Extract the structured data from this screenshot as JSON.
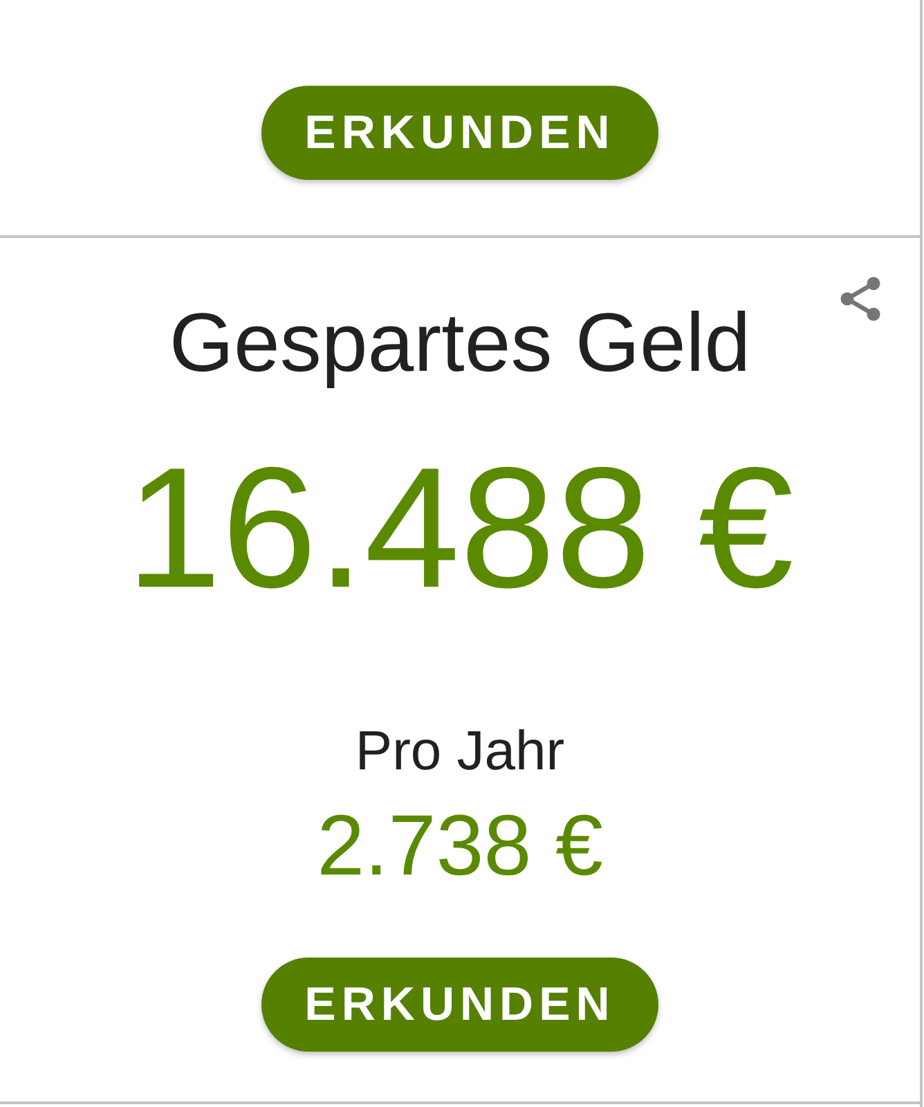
{
  "cards": [
    {
      "kind": "action",
      "button": "ERKUNDEN"
    },
    {
      "kind": "stat",
      "title": "Gespartes Geld",
      "value": "16.488 €",
      "sub_label": "Pro Jahr",
      "sub_value": "2.738 €",
      "button": "ERKUNDEN"
    }
  ]
}
